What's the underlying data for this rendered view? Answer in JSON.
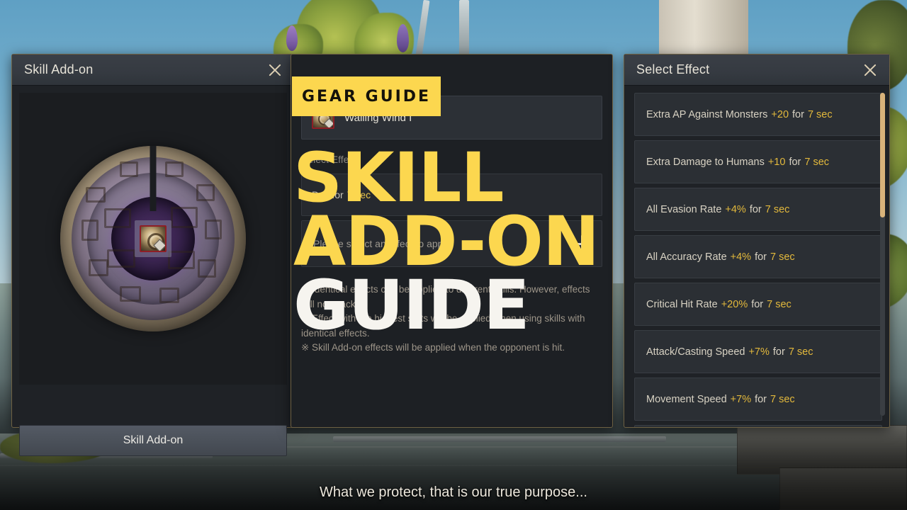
{
  "overlay": {
    "badge_label": "GEAR GUIDE",
    "headline_line1": "SKILL",
    "headline_line2": "ADD-ON",
    "headline_line3": "GUIDE",
    "badge_bg": "#fcd74f",
    "headline_yellow": "#fcd74f",
    "headline_white": "#f6f4ef"
  },
  "subtitle": "What we protect, that is our true purpose...",
  "left_panel": {
    "title": "Skill Add-on",
    "close_label": "✕",
    "item_icon_name": "ancient-stone-medallion",
    "footer_button": "Skill Add-on"
  },
  "mid_panel": {
    "skill": {
      "name": "Wailing Wind I",
      "icon_name": "wailing-wind-skill-icon"
    },
    "section_label": "Select Effect",
    "applied_effect": {
      "name": "D",
      "value": "+",
      "for_label": "for",
      "duration": "7 sec"
    },
    "add_hint": "Please select an effect to apply.",
    "add_icon": "plus-icon",
    "notes": [
      "※ Identical effects can be applied to different skills. However, effects will not stack.",
      "※ Effect with the highest stats will be applied when using skills with identical effects.",
      "※ Skill Add-on effects will be applied when the opponent is hit."
    ]
  },
  "right_panel": {
    "title": "Select Effect",
    "close_label": "✕",
    "effects": [
      {
        "name": "Extra AP Against Monsters",
        "value": "+20",
        "for_label": "for",
        "duration": "7 sec"
      },
      {
        "name": "Extra Damage to Humans",
        "value": "+10",
        "for_label": "for",
        "duration": "7 sec"
      },
      {
        "name": "All Evasion Rate",
        "value": "+4%",
        "for_label": "for",
        "duration": "7 sec"
      },
      {
        "name": "All Accuracy Rate",
        "value": "+4%",
        "for_label": "for",
        "duration": "7 sec"
      },
      {
        "name": "Critical Hit Rate",
        "value": "+20%",
        "for_label": "for",
        "duration": "7 sec"
      },
      {
        "name": "Attack/Casting Speed",
        "value": "+7%",
        "for_label": "for",
        "duration": "7 sec"
      },
      {
        "name": "Movement Speed",
        "value": "+7%",
        "for_label": "for",
        "duration": "7 sec"
      },
      {
        "name": "",
        "value": "",
        "for_label": "",
        "duration": ""
      }
    ],
    "scrollbar": {
      "thumb_color": "#d9b37a",
      "track_color": "#3a3e43"
    }
  },
  "colors": {
    "panel_bg": "#1f2226",
    "panel_border": "#6e6143",
    "header_bg": "#353a41",
    "accent_yellow": "#e3b93c",
    "text_primary": "#e7e3d8",
    "text_muted": "#9d9589"
  }
}
